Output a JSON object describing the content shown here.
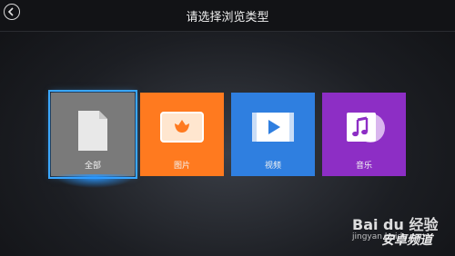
{
  "header": {
    "title": "请选择浏览类型"
  },
  "tiles": [
    {
      "label": "全部",
      "selected": true,
      "color": "#7a7a7a"
    },
    {
      "label": "图片",
      "selected": false,
      "color": "#ff7a1f"
    },
    {
      "label": "视频",
      "selected": false,
      "color": "#2f7fe0"
    },
    {
      "label": "音乐",
      "selected": false,
      "color": "#8d2ec5"
    }
  ],
  "watermark": {
    "line1": "Bai du 经验",
    "line2": "jingyan.baidu.com",
    "brand": "安卓频道"
  },
  "accent": "#3aa7ff"
}
